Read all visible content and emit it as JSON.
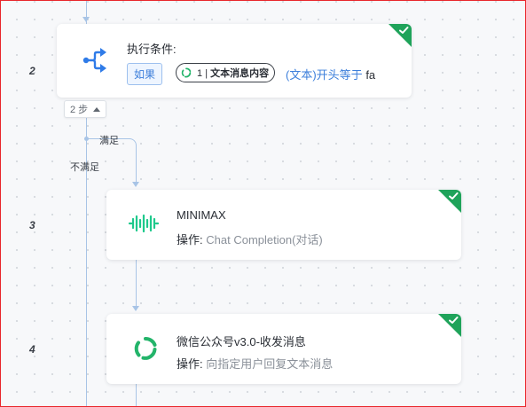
{
  "flow": {
    "steps": [
      {
        "number": "2",
        "title": "执行条件:",
        "icon": "branch-icon",
        "condition": {
          "if_label": "如果",
          "field_step": "1",
          "field_separator": "|",
          "field_name": "文本消息内容",
          "field_icon": "wechat-official-logo-icon",
          "type_label": "(文本)",
          "operator": "开头等于",
          "value": "fa"
        },
        "toggle": {
          "label": "2 步",
          "icon": "caret-up-icon"
        },
        "branches": {
          "yes_label": "满足",
          "no_label": "不满足"
        }
      },
      {
        "number": "3",
        "title": "MINIMAX",
        "icon": "minimax-waveform-icon",
        "operation_label": "操作:",
        "operation_value": "Chat Completion(对话)",
        "status_icon": "check-icon"
      },
      {
        "number": "4",
        "title": "微信公众号v3.0-收发消息",
        "icon": "wechat-official-logo-icon",
        "operation_label": "操作:",
        "operation_value": "向指定用户回复文本消息",
        "status_icon": "check-icon"
      }
    ]
  },
  "colors": {
    "connector": "#a8c4e6",
    "success_corner": "#1fa35a",
    "link_blue": "#3d7fdb",
    "minimax_green": "#1ec98c",
    "wechat_green": "#23b46a",
    "branch_icon_blue": "#2f7be8"
  }
}
